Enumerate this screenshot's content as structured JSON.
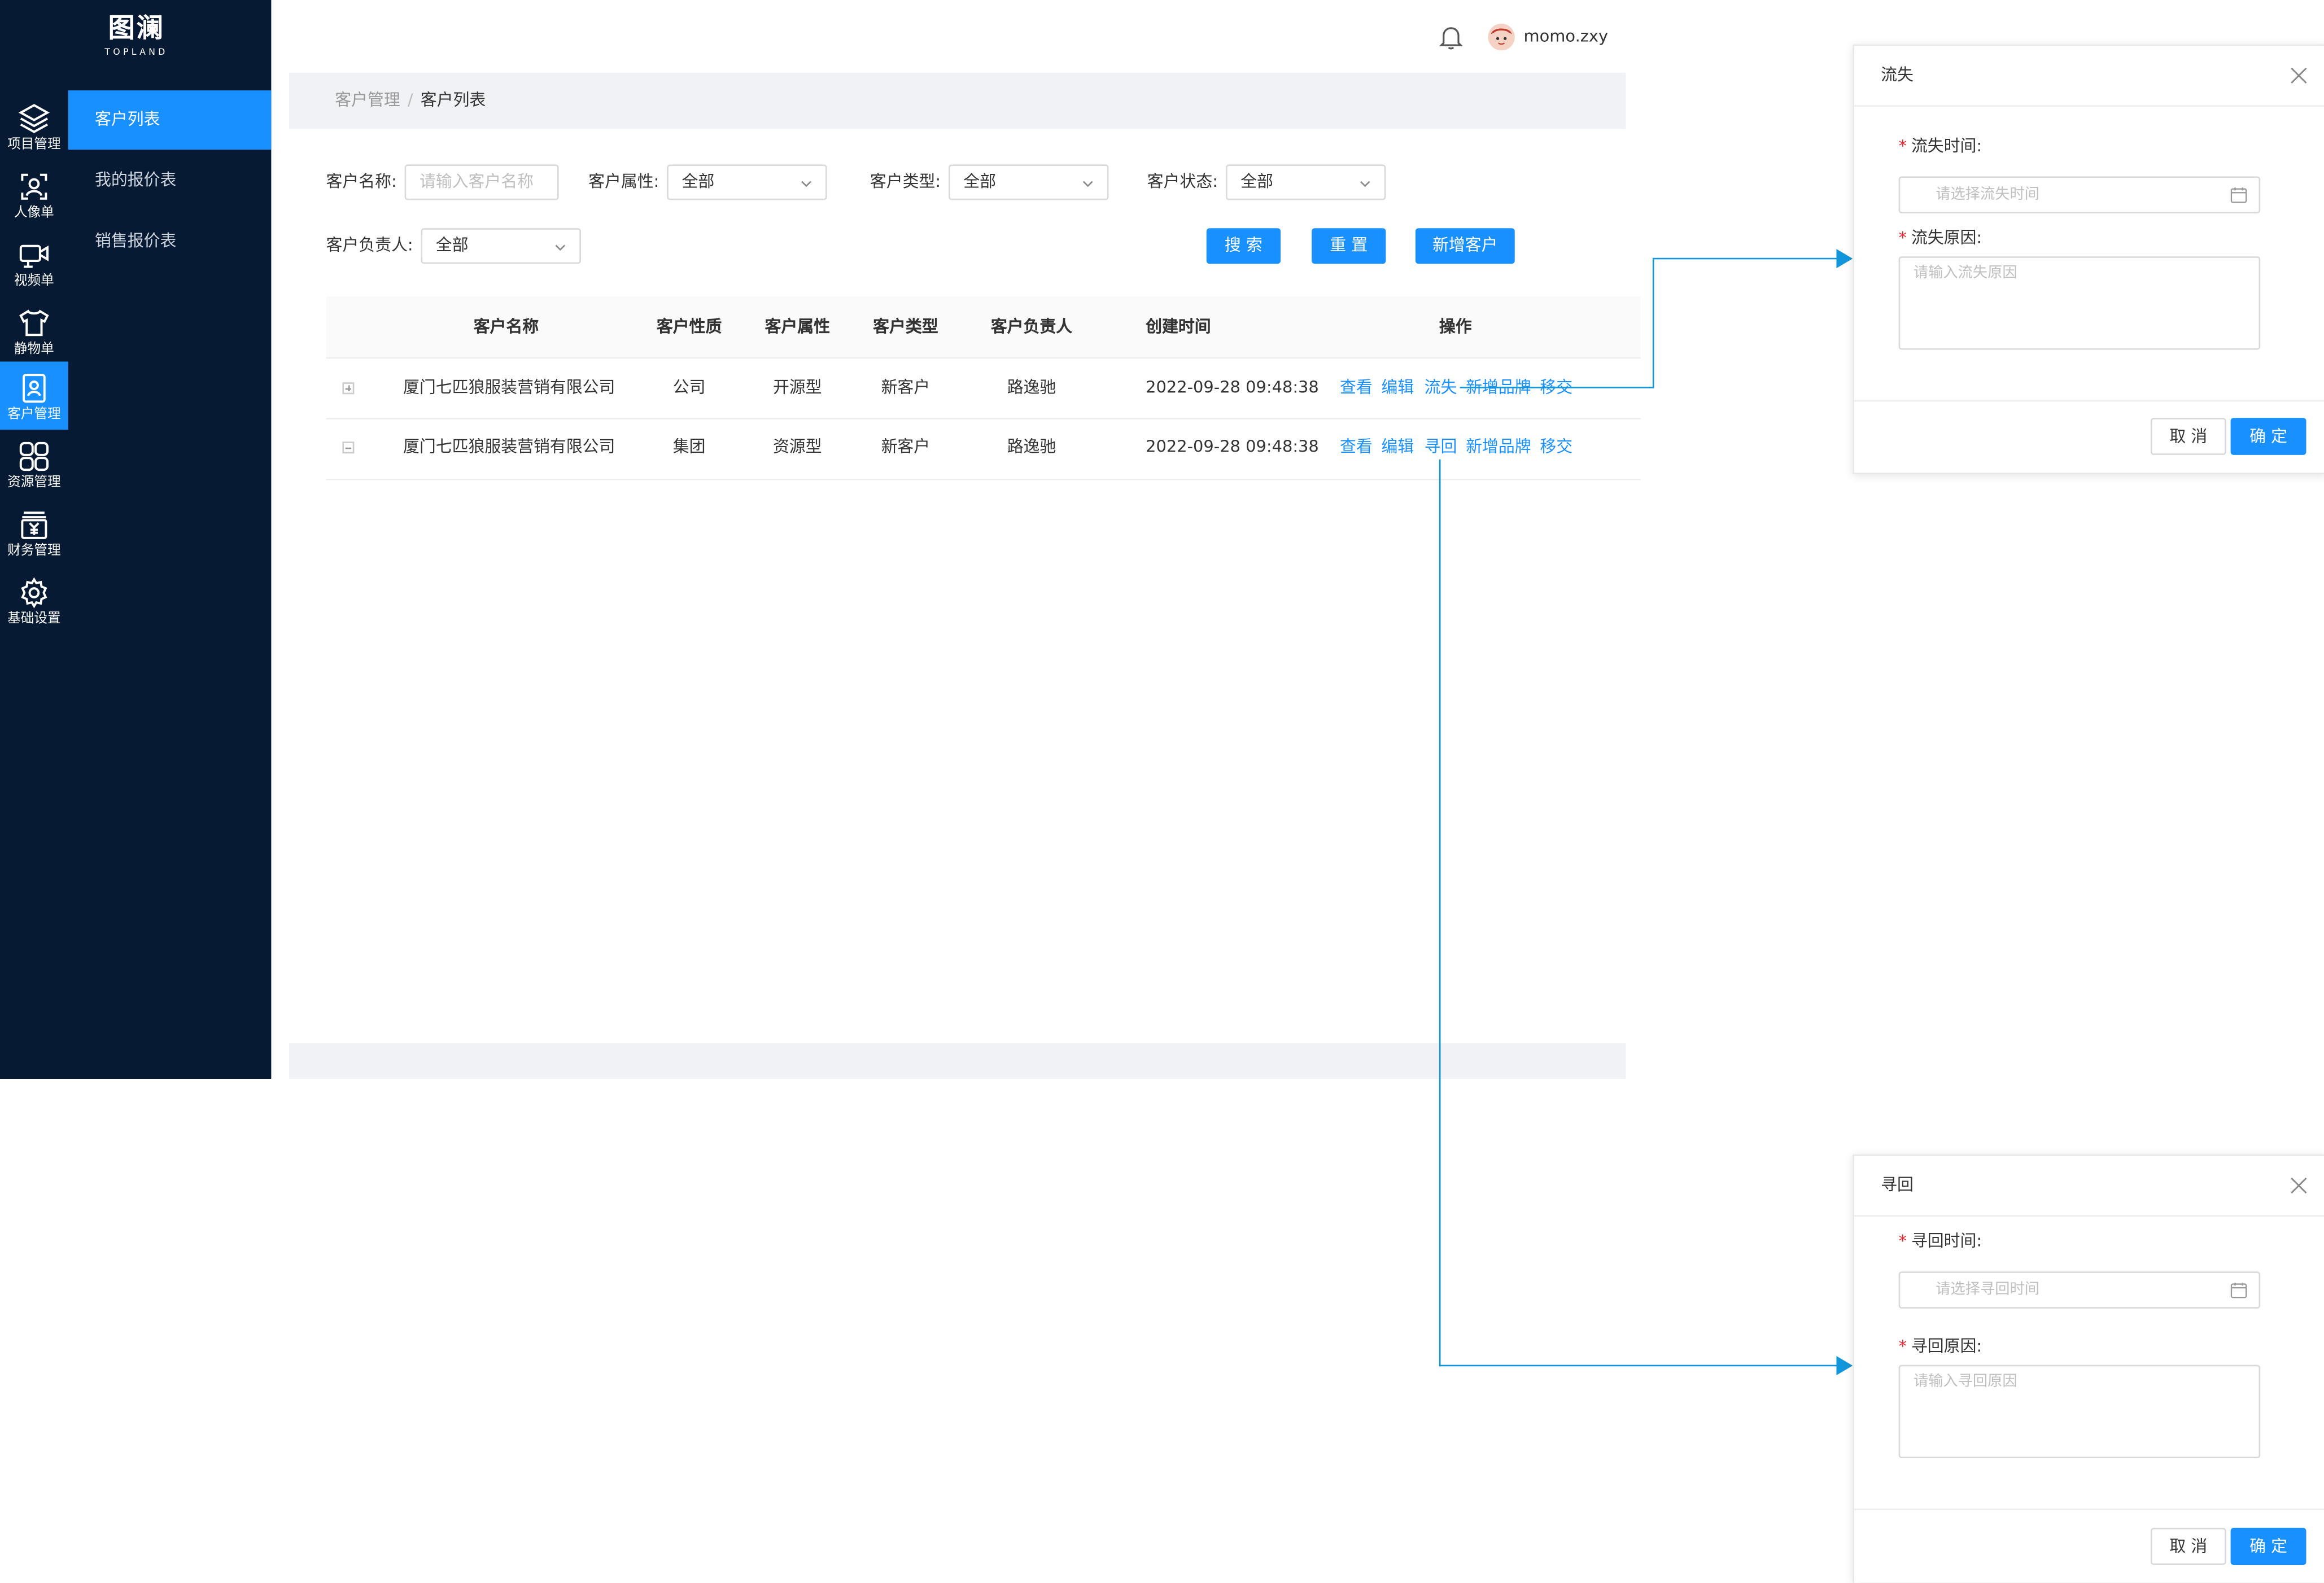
{
  "brand": {
    "name_cn": "图澜",
    "name_en": "TOPLAND"
  },
  "nav": [
    {
      "label": "项目管理",
      "icon": "layers-icon"
    },
    {
      "label": "人像单",
      "icon": "face-scan-icon"
    },
    {
      "label": "视频单",
      "icon": "video-camera-icon"
    },
    {
      "label": "静物单",
      "icon": "tshirt-icon"
    },
    {
      "label": "客户管理",
      "icon": "customer-card-icon",
      "active": true
    },
    {
      "label": "资源管理",
      "icon": "grid-apps-icon"
    },
    {
      "label": "财务管理",
      "icon": "yen-register-icon"
    },
    {
      "label": "基础设置",
      "icon": "gear-icon"
    }
  ],
  "submenu": [
    {
      "label": "客户列表",
      "active": true
    },
    {
      "label": "我的报价表"
    },
    {
      "label": "销售报价表"
    }
  ],
  "header": {
    "username": "momo.zxy"
  },
  "breadcrumb": {
    "parent": "客户管理",
    "sep": "/",
    "current": "客户列表"
  },
  "filters": {
    "name_label": "客户名称:",
    "name_placeholder": "请输入客户名称",
    "attr_label": "客户属性:",
    "attr_value": "全部",
    "type_label": "客户类型:",
    "type_value": "全部",
    "status_label": "客户状态:",
    "status_value": "全部",
    "owner_label": "客户负责人:",
    "owner_value": "全部"
  },
  "buttons": {
    "search": "搜 索",
    "reset": "重 置",
    "add": "新增客户"
  },
  "table": {
    "columns": [
      "客户名称",
      "客户性质",
      "客户属性",
      "客户类型",
      "客户负责人",
      "创建时间",
      "操作"
    ],
    "rows": [
      {
        "name": "厦门七匹狼服装营销有限公司",
        "nature": "公司",
        "attr": "开源型",
        "type": "新客户",
        "owner": "路逸驰",
        "created": "2022-09-28 09:48:38",
        "actions": [
          "查看",
          "编辑",
          "流失",
          "新增品牌",
          "移交"
        ]
      },
      {
        "name": "厦门七匹狼服装营销有限公司",
        "nature": "集团",
        "attr": "资源型",
        "type": "新客户",
        "owner": "路逸驰",
        "created": "2022-09-28 09:48:38",
        "actions": [
          "查看",
          "编辑",
          "寻回",
          "新增品牌",
          "移交"
        ]
      }
    ]
  },
  "modal_lost": {
    "title": "流失",
    "time_label": "流失时间:",
    "time_placeholder": "请选择流失时间",
    "reason_label": "流失原因:",
    "reason_placeholder": "请输入流失原因",
    "cancel": "取 消",
    "ok": "确 定"
  },
  "modal_recover": {
    "title": "寻回",
    "time_label": "寻回时间:",
    "time_placeholder": "请选择寻回时间",
    "reason_label": "寻回原因:",
    "reason_placeholder": "请输入寻回原因",
    "cancel": "取 消",
    "ok": "确 定"
  },
  "colors": {
    "sidebar": "#071a33",
    "primary": "#1890ff",
    "connector": "#1296db",
    "required": "#f5222d"
  }
}
